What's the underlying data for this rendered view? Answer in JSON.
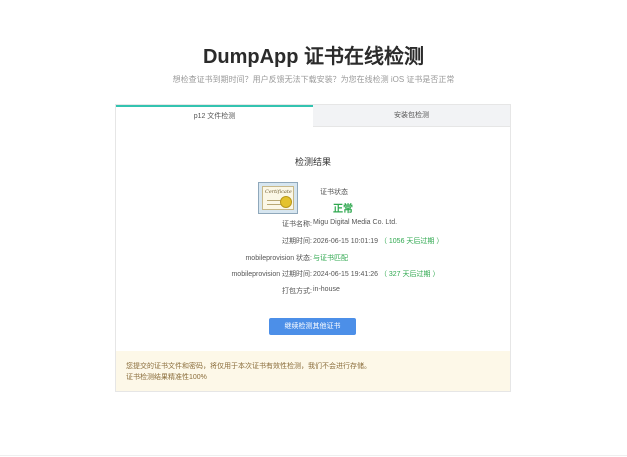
{
  "header": {
    "title": "DumpApp 证书在线检测",
    "subtitle": "想检查证书到期时间？用户反馈无法下载安装？为您在线检测 iOS 证书是否正常"
  },
  "tabs": [
    {
      "label": "p12 文件检测",
      "active": true
    },
    {
      "label": "安装包检测",
      "active": false
    }
  ],
  "result": {
    "title": "检测结果",
    "status_label": "证书状态",
    "status_value": "正常",
    "rows": [
      {
        "key": "证书名称:",
        "value": "Migu Digital Media Co. Ltd.",
        "note": ""
      },
      {
        "key": "过期时间:",
        "value": "2026-06-15 10:01:19",
        "note": "（ 1056 天后过期 ）"
      },
      {
        "key": "mobileprovision 状态:",
        "value": "",
        "note": "与证书匹配"
      },
      {
        "key": "mobileprovision 过期时间:",
        "value": "2024-06-15 19:41:26",
        "note": "（ 327 天后过期 ）"
      },
      {
        "key": "打包方式:",
        "value": "in-house",
        "note": ""
      }
    ]
  },
  "button": {
    "label": "继续检测其他证书"
  },
  "notice": {
    "line1": "您提交的证书文件和密码，将仅用于本次证书有效性检测，我们不会进行存储。",
    "line2": "证书检测结果精准性100%"
  },
  "certificate_image": {
    "script_text": "Certificate",
    "sub_text": "Standard"
  },
  "colors": {
    "accent_tab": "#33c3b0",
    "status_green": "#2fa84f",
    "button_blue": "#4c8fe8",
    "notice_bg": "#fdf8e8"
  }
}
